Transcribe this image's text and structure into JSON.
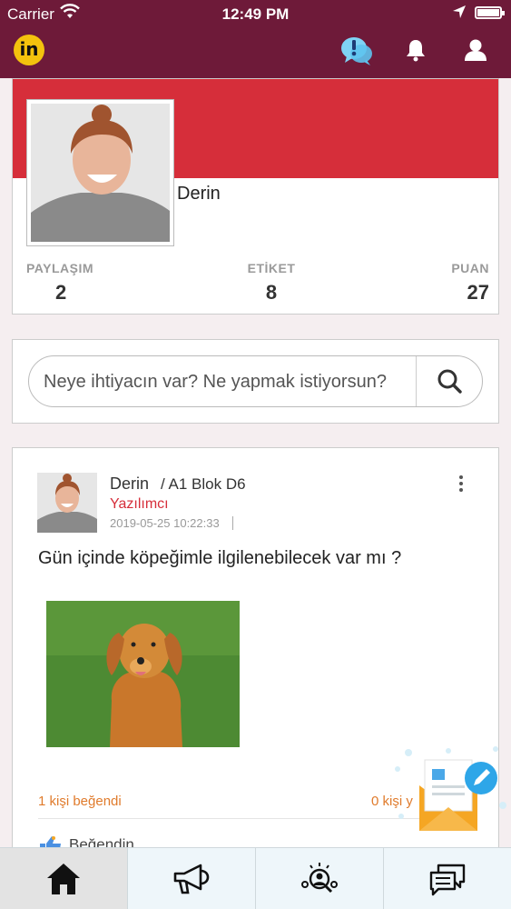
{
  "status_bar": {
    "carrier": "Carrier",
    "time": "12:49 PM"
  },
  "header": {
    "logo_text": "in"
  },
  "profile": {
    "name": "Derin",
    "stats": [
      {
        "label": "PAYLAŞIM",
        "value": "2"
      },
      {
        "label": "ETİKET",
        "value": "8"
      },
      {
        "label": "PUAN",
        "value": "27"
      }
    ]
  },
  "search": {
    "placeholder": "Neye ihtiyacın var? Ne yapmak istiyorsun?"
  },
  "post": {
    "author": "Derin",
    "location": "/ A1 Blok D6",
    "role": "Yazılımcı",
    "date": "2019-05-25 10:22:33",
    "text": "Gün içinde köpeğimle ilgilenebilecek var mı ?",
    "likes_text": "1 kişi beğendi",
    "comments_text": "0 kişi y",
    "like_action": "Beğendin"
  },
  "colors": {
    "header": "#6e1a39",
    "cover": "#d62e3a",
    "accent_orange": "#e07b2c"
  },
  "bottom_nav": {
    "items": [
      {
        "icon": "home-icon",
        "active": true
      },
      {
        "icon": "megaphone-icon",
        "active": false
      },
      {
        "icon": "people-search-icon",
        "active": false
      },
      {
        "icon": "chat-icon",
        "active": false
      }
    ]
  }
}
